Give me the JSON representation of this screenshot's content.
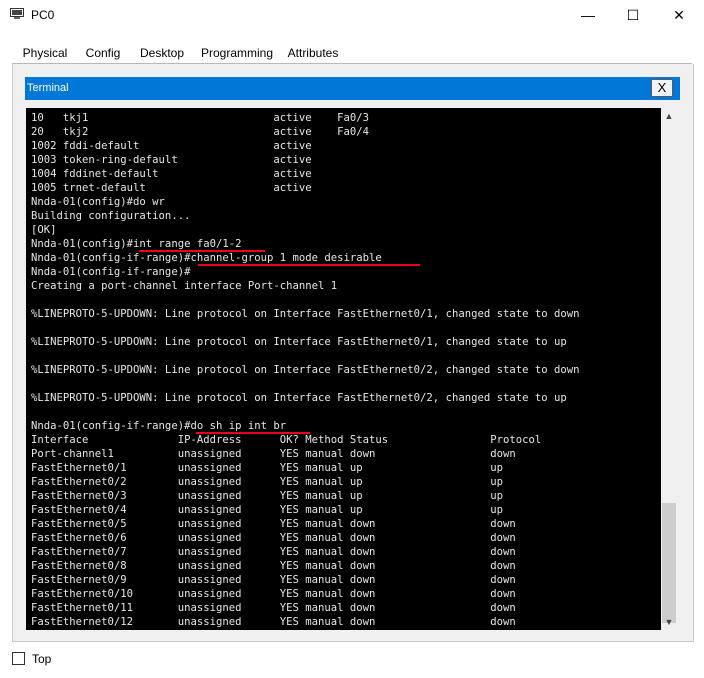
{
  "window": {
    "title": "PC0",
    "minimize": "—",
    "maximize": "☐",
    "close": "✕"
  },
  "tabs": [
    {
      "label": "Physical"
    },
    {
      "label": "Config"
    },
    {
      "label": "Desktop"
    },
    {
      "label": "Programming"
    },
    {
      "label": "Attributes"
    }
  ],
  "active_tab": "Desktop",
  "terminal": {
    "title": "Terminal",
    "close": "X",
    "lines": [
      "10   tkj1                             active    Fa0/3",
      "20   tkj2                             active    Fa0/4",
      "1002 fddi-default                     active",
      "1003 token-ring-default               active",
      "1004 fddinet-default                  active",
      "1005 trnet-default                    active",
      "Nnda-01(config)#do wr",
      "Building configuration...",
      "[OK]",
      "Nnda-01(config)#int range fa0/1-2",
      "Nnda-01(config-if-range)#channel-group 1 mode desirable",
      "Nnda-01(config-if-range)#",
      "Creating a port-channel interface Port-channel 1",
      "",
      "%LINEPROTO-5-UPDOWN: Line protocol on Interface FastEthernet0/1, changed state to down",
      "",
      "%LINEPROTO-5-UPDOWN: Line protocol on Interface FastEthernet0/1, changed state to up",
      "",
      "%LINEPROTO-5-UPDOWN: Line protocol on Interface FastEthernet0/2, changed state to down",
      "",
      "%LINEPROTO-5-UPDOWN: Line protocol on Interface FastEthernet0/2, changed state to up",
      "",
      "Nnda-01(config-if-range)#do sh ip int br",
      "Interface              IP-Address      OK? Method Status                Protocol",
      "Port-channel1          unassigned      YES manual down                  down",
      "FastEthernet0/1        unassigned      YES manual up                    up",
      "FastEthernet0/2        unassigned      YES manual up                    up",
      "FastEthernet0/3        unassigned      YES manual up                    up",
      "FastEthernet0/4        unassigned      YES manual up                    up",
      "FastEthernet0/5        unassigned      YES manual down                  down",
      "FastEthernet0/6        unassigned      YES manual down                  down",
      "FastEthernet0/7        unassigned      YES manual down                  down",
      "FastEthernet0/8        unassigned      YES manual down                  down",
      "FastEthernet0/9        unassigned      YES manual down                  down",
      "FastEthernet0/10       unassigned      YES manual down                  down",
      "FastEthernet0/11       unassigned      YES manual down                  down",
      "FastEthernet0/12       unassigned      YES manual down                  down"
    ],
    "annotation_color": "#e8001c"
  },
  "footer": {
    "top_label": "Top"
  }
}
